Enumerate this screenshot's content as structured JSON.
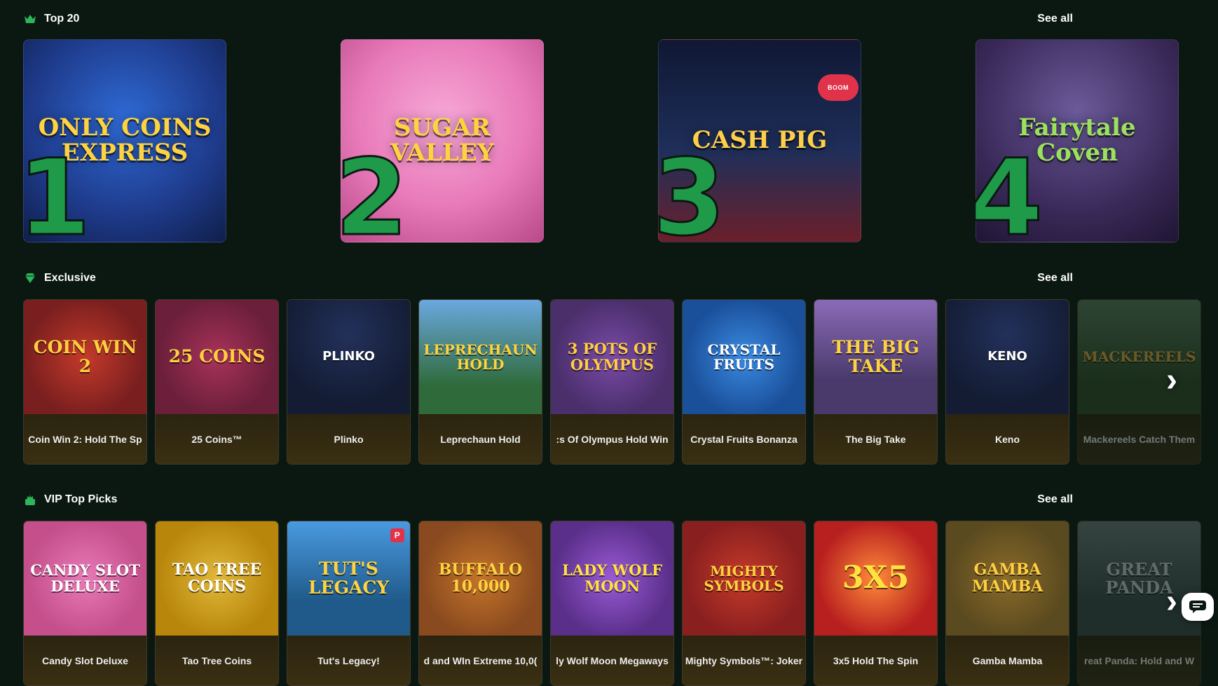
{
  "sections": {
    "top20": {
      "title": "Top 20",
      "see_all": "See all"
    },
    "exclusive": {
      "title": "Exclusive",
      "see_all": "See all"
    },
    "vip": {
      "title": "VIP Top Picks",
      "see_all": "See all"
    }
  },
  "top20": [
    {
      "rank": "1",
      "art": "ONLY COINS EXPRESS",
      "bg": "#1e3a8a"
    },
    {
      "rank": "2",
      "art": "SUGAR VALLEY",
      "bg": "#e879b9"
    },
    {
      "rank": "3",
      "art": "CASH PIG",
      "bg": "#1f2f5a",
      "badge": "BOOM"
    },
    {
      "rank": "4",
      "art": "Fairytale Coven",
      "bg": "#3b2a5a"
    }
  ],
  "exclusive": [
    {
      "name": "Coin Win 2: Hold The Sp",
      "art": "COIN WIN 2",
      "bg": "#7a1f1f"
    },
    {
      "name": "25 Coins™",
      "art": "25 COINS",
      "bg": "#6b1f3a"
    },
    {
      "name": "Plinko",
      "art": "PLINKO",
      "bg": "#131c33"
    },
    {
      "name": "Leprechaun Hold",
      "art": "LEPRECHAUN HOLD",
      "bg": "#2f6b3a"
    },
    {
      "name": ":s Of Olympus Hold Win",
      "art": "3 POTS OF OLYMPUS",
      "bg": "#4a2f6b"
    },
    {
      "name": "Crystal Fruits Bonanza",
      "art": "CRYSTAL FRUITS",
      "bg": "#1a4f9a"
    },
    {
      "name": "The Big Take",
      "art": "THE BIG TAKE",
      "bg": "#4a3a6b"
    },
    {
      "name": "Keno",
      "art": "KENO",
      "bg": "#131c33"
    },
    {
      "name": "Mackereels Catch Them",
      "art": "MACKEREELS",
      "bg": "#2f4a2a"
    }
  ],
  "vip": [
    {
      "name": "Candy Slot Deluxe",
      "art": "CANDY SLOT DELUXE",
      "bg": "#c44f8a"
    },
    {
      "name": "Tao Tree Coins",
      "art": "TAO TREE COINS",
      "bg": "#b8860b"
    },
    {
      "name": "Tut's Legacy!",
      "art": "TUT'S LEGACY",
      "bg": "#1f5a8a",
      "badge": "P"
    },
    {
      "name": "d and WIn Extreme 10,0(",
      "art": "BUFFALO 10,000",
      "bg": "#8a4a1f"
    },
    {
      "name": "ly Wolf Moon Megaways",
      "art": "LADY WOLF MOON",
      "bg": "#5a2f8a"
    },
    {
      "name": "Mighty Symbols™: Joker",
      "art": "MIGHTY SYMBOLS",
      "bg": "#8a1f1f"
    },
    {
      "name": "3x5 Hold The Spin",
      "art": "3x5",
      "bg": "#b81f1f"
    },
    {
      "name": "Gamba Mamba",
      "art": "GAMBA MAMBA",
      "bg": "#5a4a1f"
    },
    {
      "name": "reat Panda: Hold and W",
      "art": "GREAT PANDA",
      "bg": "#3a4a4a"
    }
  ]
}
